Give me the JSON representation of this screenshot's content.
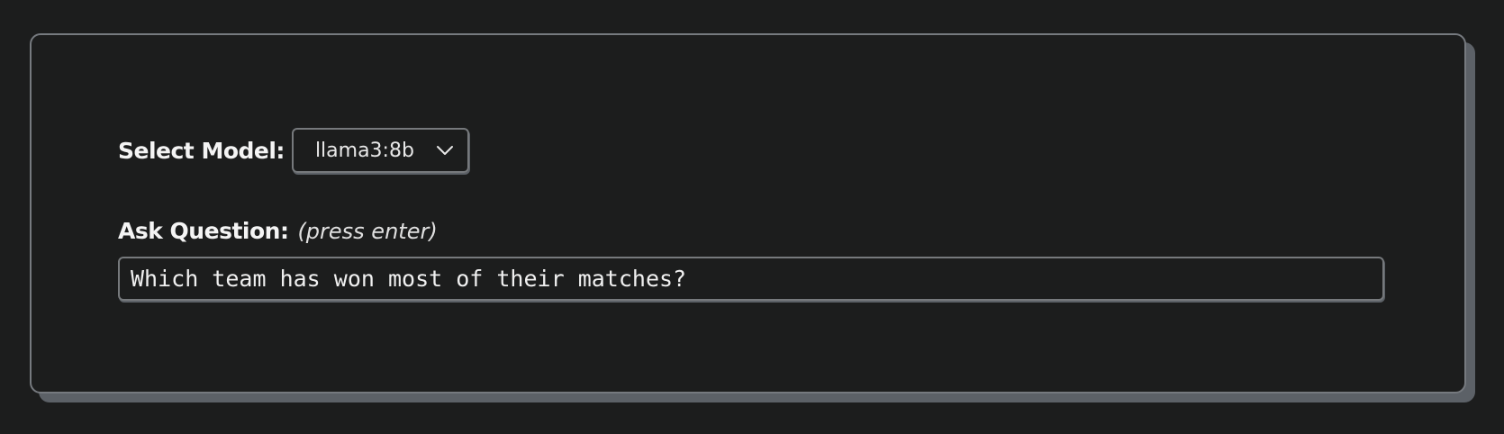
{
  "model_selector": {
    "label": "Select Model:",
    "selected": "llama3:8b",
    "chevron_icon": "chevron-down-icon"
  },
  "question": {
    "label": "Ask Question:",
    "hint": "(press enter)",
    "value": "Which team has won most of their matches?"
  },
  "colors": {
    "background": "#1c1d1d",
    "border": "#767a7f",
    "shadow": "#5c6167",
    "text": "#f2f2f2"
  }
}
